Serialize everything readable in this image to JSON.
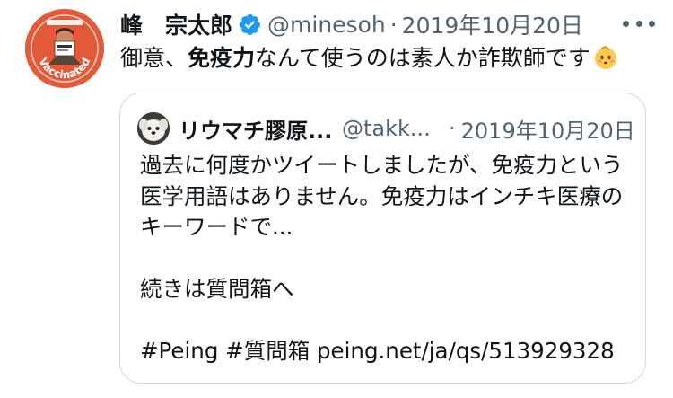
{
  "tweet": {
    "author": {
      "display_name": "峰　宗太郎",
      "handle": "@minesoh",
      "verified_icon": "verified-badge-icon",
      "avatar_badge_text": "Vaccinated"
    },
    "separator": "·",
    "date": "2019年10月20日",
    "text_part_1": "御意、",
    "text_bold": "免疫力",
    "text_part_2": "なんて使うのは素人か詐欺師です",
    "emoji_icon": "baby-face-emoji",
    "more_icon": "more-options-icon"
  },
  "quoted_tweet": {
    "author": {
      "display_name": "リウマチ膠原...",
      "handle": "@takk..."
    },
    "separator": "·",
    "date": "2019年10月20日",
    "lines": [
      "過去に何度かツイートしましたが、免疫力という",
      "医学用語はありません。免疫力はインチキ医療の",
      "キーワードで...",
      "",
      "続きは質問箱へ",
      "",
      "#Peing #質問箱 peing.net/ja/qs/513929328"
    ]
  },
  "colors": {
    "text_primary": "#0f1419",
    "text_secondary": "#536471",
    "verified_blue": "#1d9bf0",
    "border": "#cfd9de",
    "avatar_orange": "#e25a3a"
  }
}
